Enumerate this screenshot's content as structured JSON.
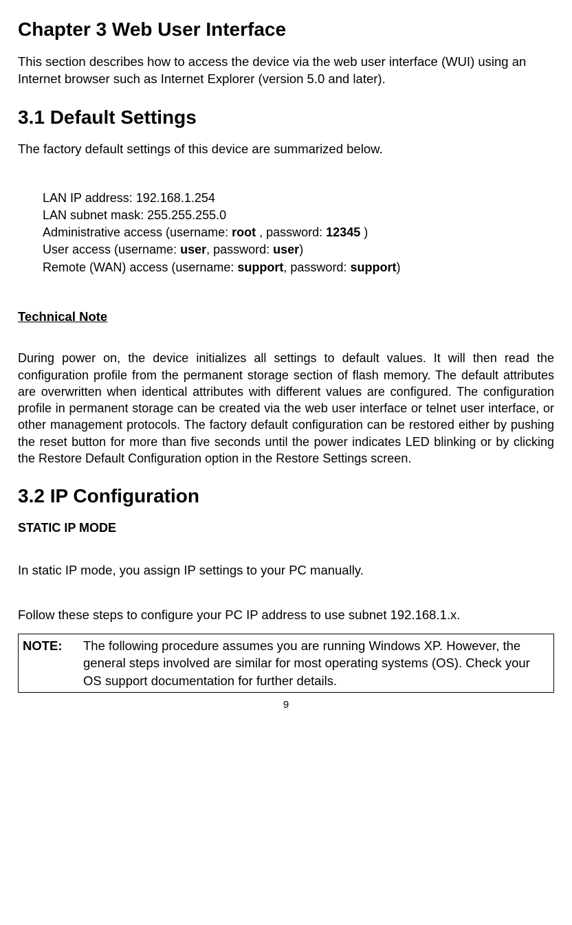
{
  "h1_chapter": "Chapter 3 Web User Interface",
  "p_intro": "This section describes how to access the device via the web user interface (WUI) using an Internet browser such as Internet Explorer (version 5.0 and later).",
  "h1_31": "3.1 Default Settings",
  "p_31_intro": "The factory default settings of this device are summarized below.",
  "settings": {
    "lan_ip_label": "LAN IP address: ",
    "lan_ip_value": "192.168.1.254",
    "lan_mask_label": "LAN subnet mask: ",
    "lan_mask_value": "255.255.255.0",
    "admin_pre": "Administrative access (username: ",
    "admin_user": "root",
    "admin_mid": " , password: ",
    "admin_pass": "12345",
    "admin_post": " )",
    "user_pre": "User access (username: ",
    "user_user": "user",
    "user_mid": ", password: ",
    "user_pass": "user",
    "user_post": ")",
    "remote_pre": "Remote (WAN) access (username: ",
    "remote_user": "support",
    "remote_mid": ", password: ",
    "remote_pass": "support",
    "remote_post": ")"
  },
  "tech_note_heading": "Technical Note",
  "tech_note_body": "During power on, the device initializes all settings to default values.  It will then read the configuration profile from the permanent storage section of flash memory.  The default attributes are overwritten when identical attributes with different values are configured.  The configuration profile in permanent storage can be created via the web user interface or telnet user interface, or other management protocols.  The factory default configuration can be restored either by pushing the reset button for more than five seconds until the power indicates LED blinking or by clicking the Restore Default Configuration option in the Restore Settings screen.",
  "h1_32": "3.2 IP Configuration",
  "static_heading": "STATIC IP MODE",
  "static_body1": "In static IP mode, you assign IP settings to your PC manually.",
  "static_body2": "Follow these steps to configure your PC IP address to use subnet 192.168.1.x.",
  "note_label": "NOTE:",
  "note_text": "The following procedure assumes you are running Windows XP. However, the general steps involved are similar for most operating systems (OS). Check your OS support documentation for further details.",
  "page_number": "9"
}
